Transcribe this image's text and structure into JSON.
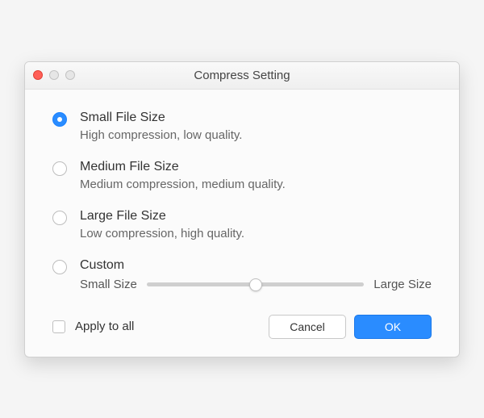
{
  "window": {
    "title": "Compress Setting"
  },
  "options": [
    {
      "label": "Small File Size",
      "description": "High compression, low quality.",
      "selected": true
    },
    {
      "label": "Medium File Size",
      "description": "Medium compression, medium quality.",
      "selected": false
    },
    {
      "label": "Large File Size",
      "description": "Low compression, high quality.",
      "selected": false
    }
  ],
  "custom": {
    "label": "Custom",
    "selected": false,
    "slider": {
      "min_label": "Small Size",
      "max_label": "Large Size",
      "value_percent": 50
    }
  },
  "apply_to_all": {
    "label": "Apply to all",
    "checked": false
  },
  "buttons": {
    "cancel": "Cancel",
    "ok": "OK"
  }
}
